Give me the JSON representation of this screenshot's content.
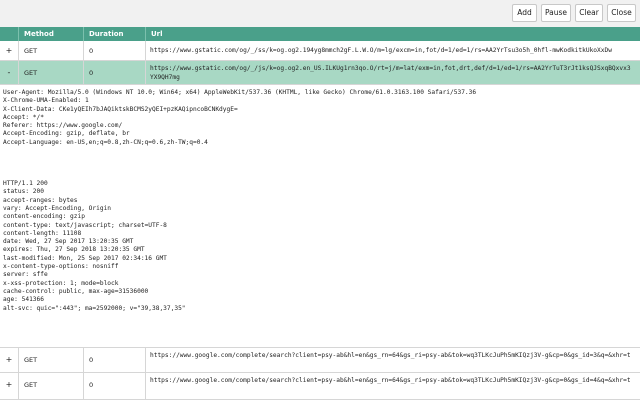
{
  "toolbar": {
    "buttons": [
      "Add",
      "Pause",
      "Clear",
      "Close"
    ]
  },
  "table": {
    "headers": [
      "Method",
      "Duration",
      "Url"
    ],
    "rows": [
      {
        "toggle": "+",
        "method": "GET",
        "duration": "0",
        "url": "https://www.gstatic.com/og/_/ss/k=og.og2.194yg8mmch2gF.L.W.O/m=lg/excm=in,fot/d=1/ed=1/rs=AA2YrTsu3o5h_0hfl-mwKodkitkUkoXxDw"
      },
      {
        "toggle": "-",
        "method": "GET",
        "duration": "0",
        "url": "https://www.gstatic.com/og/_/js/k=og.og2.en_US.ILKUg1rn3qo.O/rt=j/m=lat/exm=in,fot,drt,def/d=1/ed=1/rs=AA2YrTuT3rJt1ksQJSxqBQxvx3YX9QH7mg"
      },
      {
        "toggle": "+",
        "method": "GET",
        "duration": "0",
        "url": "https://www.google.com/complete/search?client=psy-ab&hl=en&gs_rn=64&gs_ri=psy-ab&tok=wq3TLKcJuPh5mKIQzj3V-g&cp=0&gs_id=3&q=&xhr=t"
      },
      {
        "toggle": "+",
        "method": "GET",
        "duration": "0",
        "url": "https://www.google.com/complete/search?client=psy-ab&hl=en&gs_rn=64&gs_ri=psy-ab&tok=wq3TLKcJuPh5mKIQzj3V-g&cp=0&gs_id=4&q=&xhr=t"
      }
    ]
  },
  "detail": {
    "request_headers": "User-Agent: Mozilla/5.0 (Windows NT 10.0; Win64; x64) AppleWebKit/537.36 (KHTML, like Gecko) Chrome/61.0.3163.100 Safari/537.36\nX-Chrome-UMA-Enabled: 1\nX-Client-Data: CKe1yQEIh7bJAQiktskBCMS2yQEI+pzKAQipncoBCNKdygE=\nAccept: */*\nReferer: https://www.google.com/\nAccept-Encoding: gzip, deflate, br\nAccept-Language: en-US,en;q=0.8,zh-CN;q=0.6,zh-TW;q=0.4",
    "response_headers": "HTTP/1.1 200\nstatus: 200\naccept-ranges: bytes\nvary: Accept-Encoding, Origin\ncontent-encoding: gzip\ncontent-type: text/javascript; charset=UTF-8\ncontent-length: 11108\ndate: Wed, 27 Sep 2017 13:20:35 GMT\nexpires: Thu, 27 Sep 2018 13:20:35 GMT\nlast-modified: Mon, 25 Sep 2017 02:34:16 GMT\nx-content-type-options: nosniff\nserver: sffe\nx-xss-protection: 1; mode=block\ncache-control: public, max-age=31536000\nage: 541366\nalt-svc: quic=\":443\"; ma=2592000; v=\"39,38,37,35\""
  },
  "colors": {
    "header_bg": "#4aa08a",
    "selected_row_bg": "#a8d8c4",
    "toolbar_bg": "#f1f1f1"
  }
}
